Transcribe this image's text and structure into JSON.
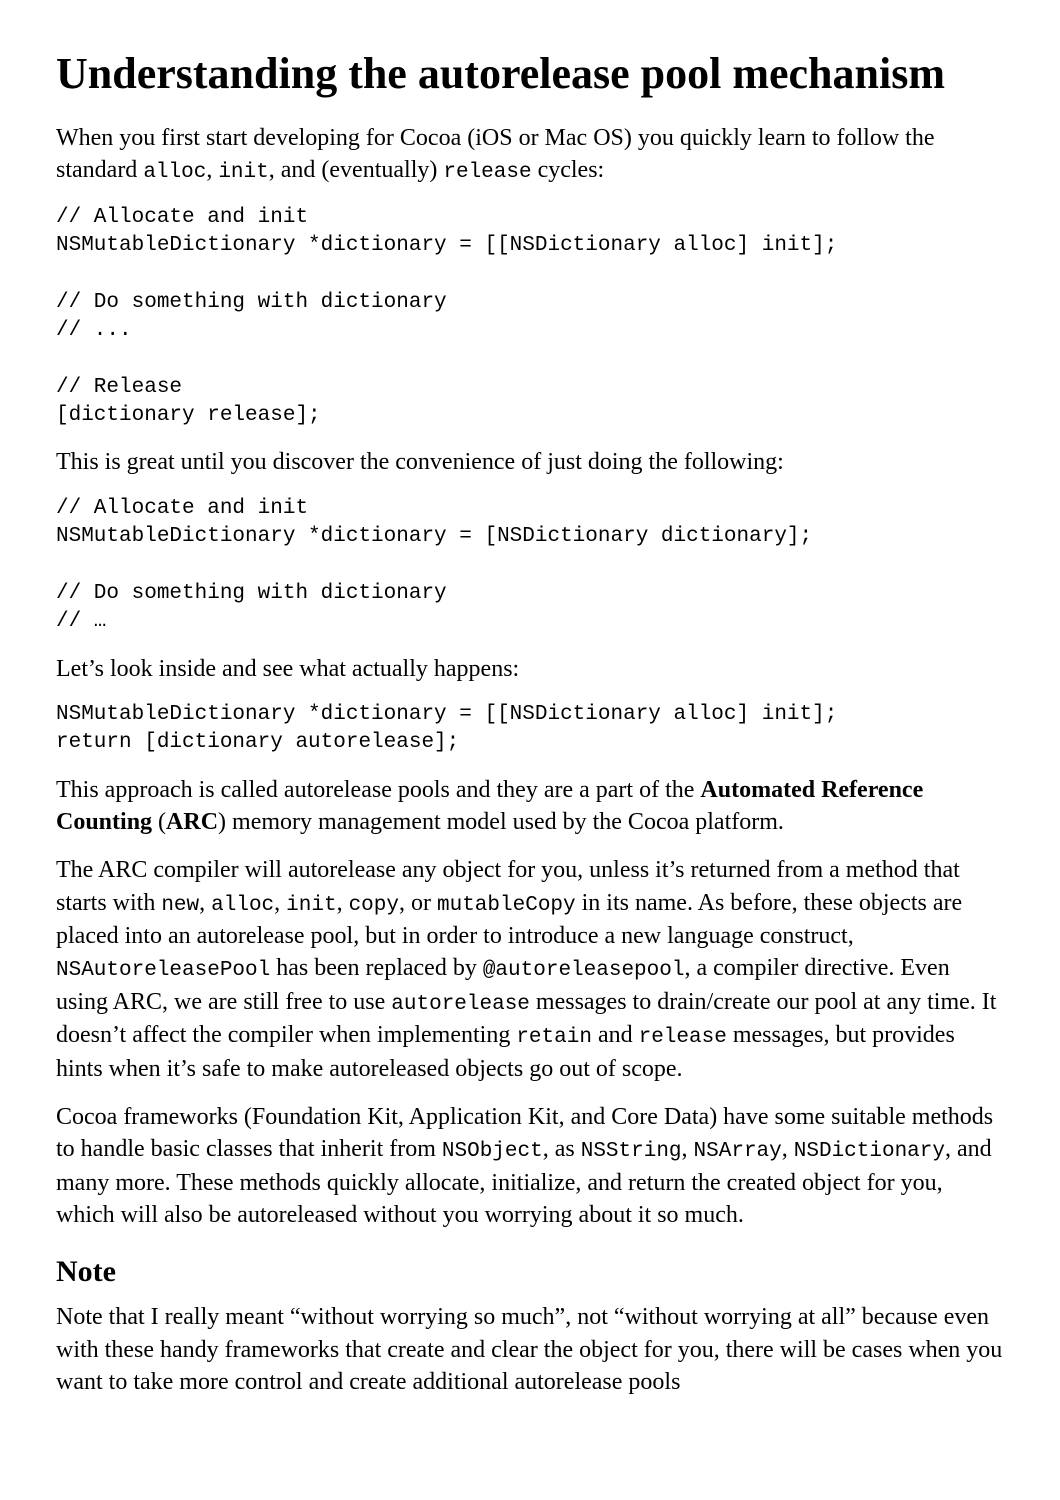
{
  "title": "Understanding the autorelease pool mechanism",
  "p1": {
    "t1": "When you first start developing for Cocoa (iOS or Mac OS) you quickly learn to follow the standard ",
    "c1": "alloc",
    "t2": ", ",
    "c2": "init",
    "t3": ", and (eventually) ",
    "c3": "release",
    "t4": " cycles:"
  },
  "code1": "// Allocate and init\nNSMutableDictionary *dictionary = [[NSDictionary alloc] init];\n\n// Do something with dictionary\n// ...\n\n// Release\n[dictionary release];",
  "p2": "This is great until you discover the convenience of just doing the following:",
  "code2": "// Allocate and init\nNSMutableDictionary *dictionary = [NSDictionary dictionary];\n\n// Do something with dictionary\n// …",
  "p3": "Let’s look inside and see what actually happens:",
  "code3": "NSMutableDictionary *dictionary = [[NSDictionary alloc] init];\nreturn [dictionary autorelease];",
  "p4": {
    "t1": "This approach is called autorelease pools and they are a part of the ",
    "b1": "Automated Reference Counting",
    "t2": " (",
    "b2": "ARC",
    "t3": ") memory management model used by the Cocoa platform."
  },
  "p5": {
    "t1": "The ARC compiler will autorelease any object for you, unless it’s returned from a method that starts with ",
    "c1": "new",
    "t2": ", ",
    "c2": "alloc",
    "t3": ", ",
    "c3": "init",
    "t4": ", ",
    "c4": "copy",
    "t5": ", or ",
    "c5": "mutableCopy",
    "t6": " in its name. As before, these objects are placed into an autorelease pool, but in order to introduce a new language construct, ",
    "c6": "NSAutoreleasePool",
    "t7": " has been replaced by ",
    "c7": "@autoreleasepool",
    "t8": ", a compiler directive. Even using ARC, we are still free to use ",
    "c8": "autorelease",
    "t9": " messages to drain/create our pool at any time. It doesn’t affect the compiler when implementing ",
    "c9": "retain",
    "t10": " and ",
    "c10": "release",
    "t11": " messages, but provides hints when it’s safe to make autoreleased objects go out of scope."
  },
  "p6": {
    "t1": "Cocoa frameworks (Foundation Kit, Application Kit, and Core Data) have some suitable methods to handle basic classes that inherit from ",
    "c1": "NSObject",
    "t2": ", as ",
    "c2": "NSString",
    "t3": ", ",
    "c3": "NSArray",
    "t4": ", ",
    "c4": "NSDictionary",
    "t5": ", and many more. These methods quickly allocate, initialize, and return the created object for you, which will also be autoreleased without you worrying about it so much."
  },
  "note_heading": "Note",
  "p7": "Note that I really meant “without worrying so much”, not “without worrying at all” because even with these handy frameworks that create and clear the object for you, there will be cases when you want to take more control and create additional autorelease pools"
}
